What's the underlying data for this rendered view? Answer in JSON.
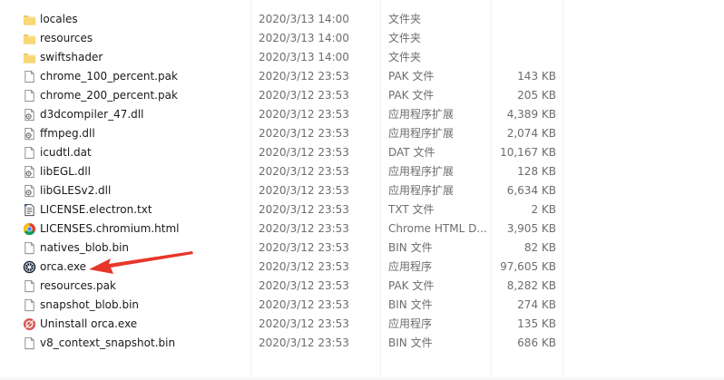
{
  "files": [
    {
      "name": "locales",
      "date": "2020/3/13 14:00",
      "type": "文件夹",
      "size": "",
      "icon": "folder-icon"
    },
    {
      "name": "resources",
      "date": "2020/3/13 14:00",
      "type": "文件夹",
      "size": "",
      "icon": "folder-icon"
    },
    {
      "name": "swiftshader",
      "date": "2020/3/13 14:00",
      "type": "文件夹",
      "size": "",
      "icon": "folder-icon"
    },
    {
      "name": "chrome_100_percent.pak",
      "date": "2020/3/12 23:53",
      "type": "PAK 文件",
      "size": "143 KB",
      "icon": "file-icon"
    },
    {
      "name": "chrome_200_percent.pak",
      "date": "2020/3/12 23:53",
      "type": "PAK 文件",
      "size": "205 KB",
      "icon": "file-icon"
    },
    {
      "name": "d3dcompiler_47.dll",
      "date": "2020/3/12 23:53",
      "type": "应用程序扩展",
      "size": "4,389 KB",
      "icon": "dll-icon"
    },
    {
      "name": "ffmpeg.dll",
      "date": "2020/3/12 23:53",
      "type": "应用程序扩展",
      "size": "2,074 KB",
      "icon": "dll-icon"
    },
    {
      "name": "icudtl.dat",
      "date": "2020/3/12 23:53",
      "type": "DAT 文件",
      "size": "10,167 KB",
      "icon": "file-icon"
    },
    {
      "name": "libEGL.dll",
      "date": "2020/3/12 23:53",
      "type": "应用程序扩展",
      "size": "128 KB",
      "icon": "dll-icon"
    },
    {
      "name": "libGLESv2.dll",
      "date": "2020/3/12 23:53",
      "type": "应用程序扩展",
      "size": "6,634 KB",
      "icon": "dll-icon"
    },
    {
      "name": "LICENSE.electron.txt",
      "date": "2020/3/12 23:53",
      "type": "TXT 文件",
      "size": "2 KB",
      "icon": "text-file-icon"
    },
    {
      "name": "LICENSES.chromium.html",
      "date": "2020/3/12 23:53",
      "type": "Chrome HTML D...",
      "size": "3,905 KB",
      "icon": "chrome-icon"
    },
    {
      "name": "natives_blob.bin",
      "date": "2020/3/12 23:53",
      "type": "BIN 文件",
      "size": "82 KB",
      "icon": "file-icon"
    },
    {
      "name": "orca.exe",
      "date": "2020/3/12 23:53",
      "type": "应用程序",
      "size": "97,605 KB",
      "icon": "orca-app-icon"
    },
    {
      "name": "resources.pak",
      "date": "2020/3/12 23:53",
      "type": "PAK 文件",
      "size": "8,282 KB",
      "icon": "file-icon"
    },
    {
      "name": "snapshot_blob.bin",
      "date": "2020/3/12 23:53",
      "type": "BIN 文件",
      "size": "274 KB",
      "icon": "file-icon"
    },
    {
      "name": "Uninstall orca.exe",
      "date": "2020/3/12 23:53",
      "type": "应用程序",
      "size": "135 KB",
      "icon": "uninstall-app-icon"
    },
    {
      "name": "v8_context_snapshot.bin",
      "date": "2020/3/12 23:53",
      "type": "BIN 文件",
      "size": "686 KB",
      "icon": "file-icon"
    }
  ],
  "colors": {
    "folder": "#f8d775",
    "folder_dark": "#e6b64a",
    "arrow": "#e8362a",
    "chrome_red": "#db4437",
    "chrome_yellow": "#f4c20d",
    "chrome_green": "#0f9d58",
    "chrome_blue": "#4285f4"
  }
}
